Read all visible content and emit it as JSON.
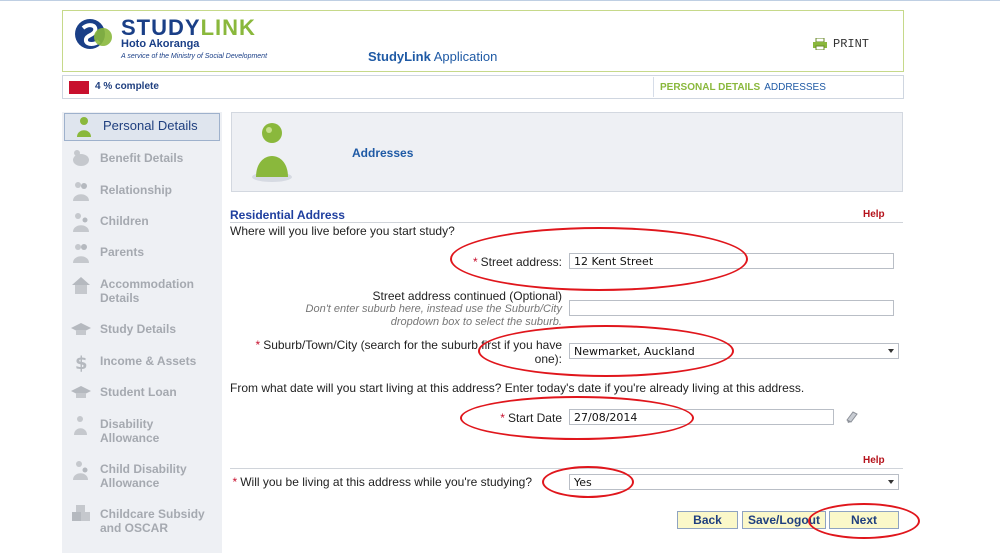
{
  "header": {
    "brand_main": "STUDY",
    "brand_accent": "LINK",
    "brand_sub": "Hoto Akoranga",
    "brand_tag": "A service of the Ministry of Social Development",
    "app_bold": "StudyLink",
    "app_rest": "Application",
    "print_label": "PRINT"
  },
  "progress": {
    "percent": 4,
    "text": "4 % complete",
    "crumb_current": "PERSONAL DETAILS",
    "crumb_next": "ADDRESSES",
    "fill_color": "#c8102e"
  },
  "sidebar": {
    "items": [
      {
        "label": "Personal Details",
        "icon": "person-icon"
      },
      {
        "label": "Benefit Details",
        "icon": "piggy-bank-icon"
      },
      {
        "label": "Relationship",
        "icon": "couple-icon"
      },
      {
        "label": "Children",
        "icon": "children-icon"
      },
      {
        "label": "Parents",
        "icon": "parents-icon"
      },
      {
        "label": "Accommodation Details",
        "icon": "house-icon"
      },
      {
        "label": "Study Details",
        "icon": "graduation-cap-icon"
      },
      {
        "label": "Income & Assets",
        "icon": "dollar-icon"
      },
      {
        "label": "Student Loan",
        "icon": "graduation-cap-icon"
      },
      {
        "label": "Disability Allowance",
        "icon": "person-icon"
      },
      {
        "label": "Child Disability Allowance",
        "icon": "child-icon"
      },
      {
        "label": "Childcare Subsidy and OSCAR",
        "icon": "blocks-icon"
      }
    ]
  },
  "panel": {
    "title": "Addresses"
  },
  "form": {
    "section_title": "Residential Address",
    "help_label": "Help",
    "intro_question": "Where will you live before you start study?",
    "street_label": "Street address:",
    "street_value": "12 Kent Street",
    "street2_label": "Street address continued (Optional)",
    "street2_hint": "Don't enter suburb here, instead use the Suburb/City dropdown box to select the suburb.",
    "street2_value": "",
    "suburb_label": "Suburb/Town/City (search for the suburb first if you have one):",
    "suburb_value": "Newmarket, Auckland",
    "date_question": "From what date will you start living at this address? Enter today's date if you're already living at this address.",
    "start_date_label": "Start Date",
    "start_date_value": "27/08/2014",
    "help2_label": "Help",
    "living_label": "Will you be living at this address while you're studying?",
    "living_value": "Yes"
  },
  "buttons": {
    "back": "Back",
    "save": "Save/Logout",
    "next": "Next"
  },
  "colors": {
    "annotation": "#e0161c",
    "brand_blue": "#1a3f87",
    "brand_green": "#8ab83c"
  }
}
